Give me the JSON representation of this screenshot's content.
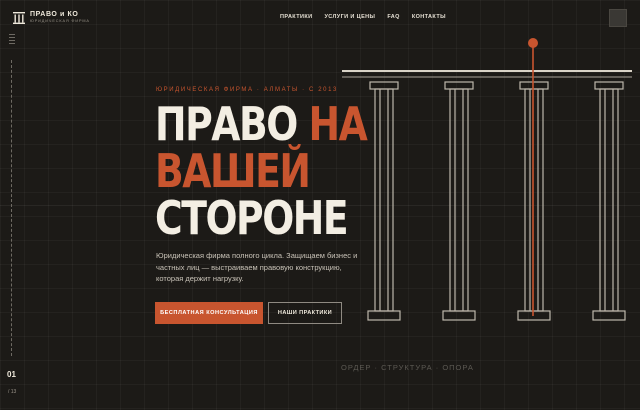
{
  "header": {
    "logo_name": "ПРАВО и КО",
    "logo_sub": "ЮРИДИЧЕСКАЯ ФИРМА",
    "nav": [
      {
        "label": "ПРАКТИКИ"
      },
      {
        "label": "УСЛУГИ И ЦЕНЫ"
      },
      {
        "label": "FAQ"
      },
      {
        "label": "КОНТАКТЫ"
      }
    ]
  },
  "rail": {
    "current_page": "01",
    "total_pages": "/ 13"
  },
  "hero": {
    "eyebrow": "ЮРИДИЧЕСКАЯ ФИРМА · АЛМАТЫ · С 2013",
    "title_line1_word1": "ПРАВО",
    "title_line1_word2": "НА",
    "title_line2": "ВАШЕЙ",
    "title_line3": "СТОРОНЕ",
    "description": "Юридическая фирма полного цикла. Защищаем бизнес и частных лиц — выстраиваем правовую конструкцию, которая держит нагрузку.",
    "primary_button": "БЕСПЛАТНАЯ КОНСУЛЬТАЦИЯ",
    "secondary_button": "НАШИ ПРАКТИКИ",
    "caption": "ОРДЕР · СТРУКТУРА · ОПОРА"
  },
  "colors": {
    "accent": "#c8552f",
    "background": "#1c1a17",
    "text": "#f3eee3"
  },
  "icons": [
    "columns-logo-icon",
    "menu-icon"
  ]
}
